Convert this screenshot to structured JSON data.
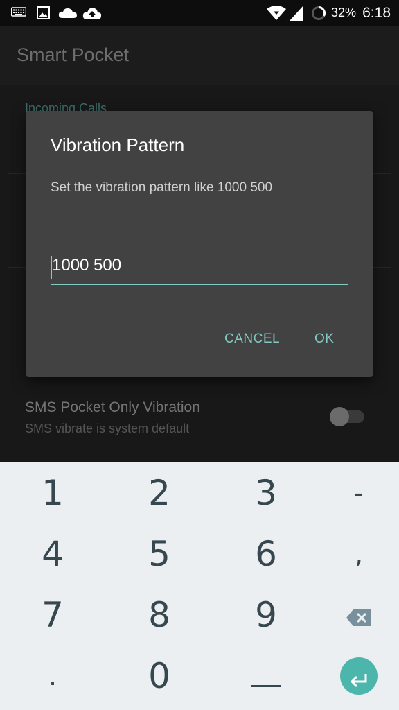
{
  "status_bar": {
    "battery": "32%",
    "time": "6:18",
    "icons": [
      "keyboard-icon",
      "image-icon",
      "onedrive-cloud-icon",
      "cloud-upload-icon",
      "wifi-icon",
      "signal-icon",
      "battery-ring-icon"
    ]
  },
  "app_bar": {
    "title": "Smart Pocket"
  },
  "background_list": {
    "section_header": "Incoming Calls",
    "sms_row": {
      "title": "SMS Pocket Only Vibration",
      "subtitle": "SMS vibrate is system default",
      "toggle_on": false
    }
  },
  "dialog": {
    "title": "Vibration Pattern",
    "message": "Set the vibration pattern like 1000 500",
    "input_value": "1000 500",
    "cancel_label": "CANCEL",
    "ok_label": "OK"
  },
  "keyboard": {
    "rows": [
      [
        "1",
        "2",
        "3",
        "-"
      ],
      [
        "4",
        "5",
        "6",
        ","
      ],
      [
        "7",
        "8",
        "9",
        "backspace"
      ],
      [
        ".",
        "0",
        "space",
        "enter"
      ]
    ],
    "labels": {
      "k1": "1",
      "k2": "2",
      "k3": "3",
      "dash": "-",
      "k4": "4",
      "k5": "5",
      "k6": "6",
      "comma": ",",
      "k7": "7",
      "k8": "8",
      "k9": "9",
      "period": ".",
      "k0": "0"
    }
  },
  "colors": {
    "accent": "#80cbc4",
    "enter_button": "#4db6ac",
    "dialog_bg": "#424242",
    "keyboard_bg": "#eceff1",
    "key_text": "#37474f"
  }
}
